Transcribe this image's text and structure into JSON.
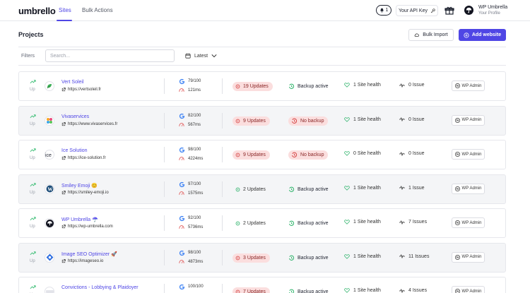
{
  "app": {
    "logo_text": "umbrello"
  },
  "nav": {
    "tabs": [
      {
        "label": "Sites",
        "active": true
      },
      {
        "label": "Bulk Actions",
        "active": false
      }
    ],
    "notifications_count": "1",
    "api_key_label": "Your API Key",
    "profile": {
      "name": "WP Umbrella",
      "subtitle": "Your Profile"
    }
  },
  "header": {
    "title": "Projects",
    "bulk_import_label": "Bulk Import",
    "add_website_label": "Add website"
  },
  "filters": {
    "label": "Filters",
    "search_placeholder": "Search...",
    "sort_label": "Latest"
  },
  "colors": {
    "accent": "#4f46e5",
    "warning_bg": "#fbdede",
    "ok_green": "#2fb36b"
  },
  "sites": [
    {
      "status": "Up",
      "name": "Vert Soleil",
      "url": "https://vertsoleil.fr",
      "favicon": "leaf-logo-icon",
      "score": "79/100",
      "speed": "121ms",
      "updates": "19 Updates",
      "updates_warn": true,
      "backup": "Backup active",
      "backup_ok": true,
      "health": "1 Site health",
      "issues": "0 Issue",
      "wp_admin": "WP Admin"
    },
    {
      "status": "Up",
      "name": "Vivaservices",
      "url": "https://www.vivaservices.fr",
      "favicon": "colorful-logo-icon",
      "score": "82/100",
      "speed": "567ms",
      "updates": "9 Updates",
      "updates_warn": true,
      "backup": "No backup",
      "backup_ok": false,
      "health": "1 Site health",
      "issues": "0 Issue",
      "wp_admin": "WP Admin"
    },
    {
      "status": "Up",
      "name": "Ice Solution",
      "url": "https://ice-solution.fr",
      "favicon": "ice-logo-icon",
      "score": "98/100",
      "speed": "4224ms",
      "updates": "9 Updates",
      "updates_warn": true,
      "backup": "No backup",
      "backup_ok": false,
      "health": "0 Site health",
      "issues": "0 Issue",
      "wp_admin": "WP Admin"
    },
    {
      "status": "Up",
      "name": "Smiley Emoji 😊",
      "url": "https://smiley-emoji.io",
      "favicon": "wordpress-logo-icon",
      "score": "97/100",
      "speed": "1575ms",
      "updates": "2 Updates",
      "updates_warn": false,
      "backup": "Backup active",
      "backup_ok": true,
      "health": "1 Site health",
      "issues": "1 Issue",
      "wp_admin": "WP Admin"
    },
    {
      "status": "Up",
      "name": "WP Umbrella ☂️",
      "url": "https://wp-umbrella.com",
      "favicon": "umbrella-logo-icon",
      "score": "92/100",
      "speed": "5736ms",
      "updates": "2 Updates",
      "updates_warn": false,
      "backup": "Backup active",
      "backup_ok": true,
      "health": "1 Site health",
      "issues": "7 Issues",
      "wp_admin": "WP Admin"
    },
    {
      "status": "Up",
      "name": "Image SEO Optimizer 🚀",
      "url": "https://imageseo.io",
      "favicon": "imageseo-logo-icon",
      "score": "98/100",
      "speed": "4873ms",
      "updates": "3 Updates",
      "updates_warn": true,
      "backup": "Backup active",
      "backup_ok": true,
      "health": "1 Site health",
      "issues": "11 Issues",
      "wp_admin": "WP Admin"
    },
    {
      "status": "Up",
      "name": "Convictions - Lobbying & Plaidoyer",
      "url": "",
      "favicon": "convictions-logo-icon",
      "score": "100/100",
      "speed": "",
      "updates": "7 Updates",
      "updates_warn": true,
      "backup": "Backup active",
      "backup_ok": true,
      "health": "1 Site health",
      "issues": "4 Issues",
      "wp_admin": "WP Admin"
    }
  ]
}
